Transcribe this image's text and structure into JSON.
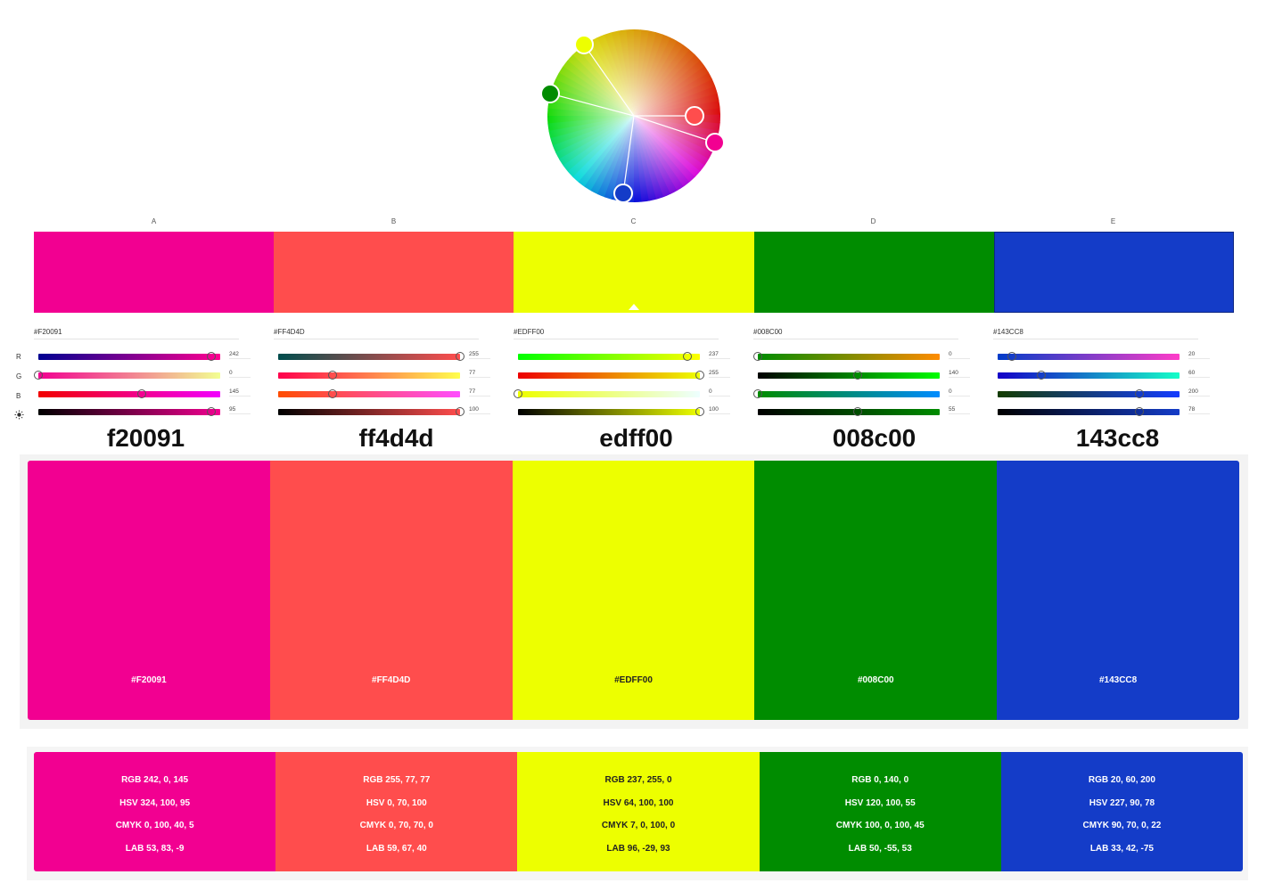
{
  "wheel": {
    "handles": [
      {
        "name": "wheel-handle-a",
        "color": "#F20091"
      },
      {
        "name": "wheel-handle-b",
        "color": "#FF4D4D"
      },
      {
        "name": "wheel-handle-c",
        "color": "#EDFF00"
      },
      {
        "name": "wheel-handle-d",
        "color": "#008C00"
      },
      {
        "name": "wheel-handle-e",
        "color": "#143CC8"
      }
    ]
  },
  "row_labels": {
    "r": "R",
    "g": "G",
    "b": "B",
    "brightness_icon": "sun-icon"
  },
  "colors": [
    {
      "letter": "A",
      "hex": "#F20091",
      "hex_lower": "f20091",
      "text_color": "#ffffff",
      "rgb": "RGB 242, 0, 145",
      "hsv": "HSV 324, 100, 95",
      "cmyk": "CMYK 0, 100, 40, 5",
      "lab": "LAB 53, 83, -9",
      "sliders": {
        "r": "242",
        "g": "0",
        "b": "145",
        "brightness": "95"
      },
      "levels": {
        "r": 0.95,
        "g": 0.0,
        "b": 0.57,
        "brightness": 0.95
      }
    },
    {
      "letter": "B",
      "hex": "#FF4D4D",
      "hex_lower": "ff4d4d",
      "text_color": "#ffffff",
      "rgb": "RGB 255, 77, 77",
      "hsv": "HSV 0, 70, 100",
      "cmyk": "CMYK 0, 70, 70, 0",
      "lab": "LAB 59, 67, 40",
      "sliders": {
        "r": "255",
        "g": "77",
        "b": "77",
        "brightness": "100"
      },
      "levels": {
        "r": 1.0,
        "g": 0.3,
        "b": 0.3,
        "brightness": 1.0
      }
    },
    {
      "letter": "C",
      "hex": "#EDFF00",
      "hex_lower": "edff00",
      "text_color": "#222222",
      "rgb": "RGB 237, 255, 0",
      "hsv": "HSV 64, 100, 100",
      "cmyk": "CMYK 7, 0, 100, 0",
      "lab": "LAB 96, -29, 93",
      "sliders": {
        "r": "237",
        "g": "255",
        "b": "0",
        "brightness": "100"
      },
      "levels": {
        "r": 0.93,
        "g": 1.0,
        "b": 0.0,
        "brightness": 1.0
      }
    },
    {
      "letter": "D",
      "hex": "#008C00",
      "hex_lower": "008c00",
      "text_color": "#ffffff",
      "rgb": "RGB 0, 140, 0",
      "hsv": "HSV 120, 100, 55",
      "cmyk": "CMYK 100, 0, 100, 45",
      "lab": "LAB 50, -55, 53",
      "sliders": {
        "r": "0",
        "g": "140",
        "b": "0",
        "brightness": "55"
      },
      "levels": {
        "r": 0.0,
        "g": 0.55,
        "b": 0.0,
        "brightness": 0.55
      }
    },
    {
      "letter": "E",
      "hex": "#143CC8",
      "hex_lower": "143cc8",
      "text_color": "#ffffff",
      "rgb": "RGB 20, 60, 200",
      "hsv": "HSV 227, 90, 78",
      "cmyk": "CMYK 90, 70, 0, 22",
      "lab": "LAB 33, 42, -75",
      "sliders": {
        "r": "20",
        "g": "60",
        "b": "200",
        "brightness": "78"
      },
      "levels": {
        "r": 0.08,
        "g": 0.24,
        "b": 0.78,
        "brightness": 0.78
      }
    }
  ]
}
